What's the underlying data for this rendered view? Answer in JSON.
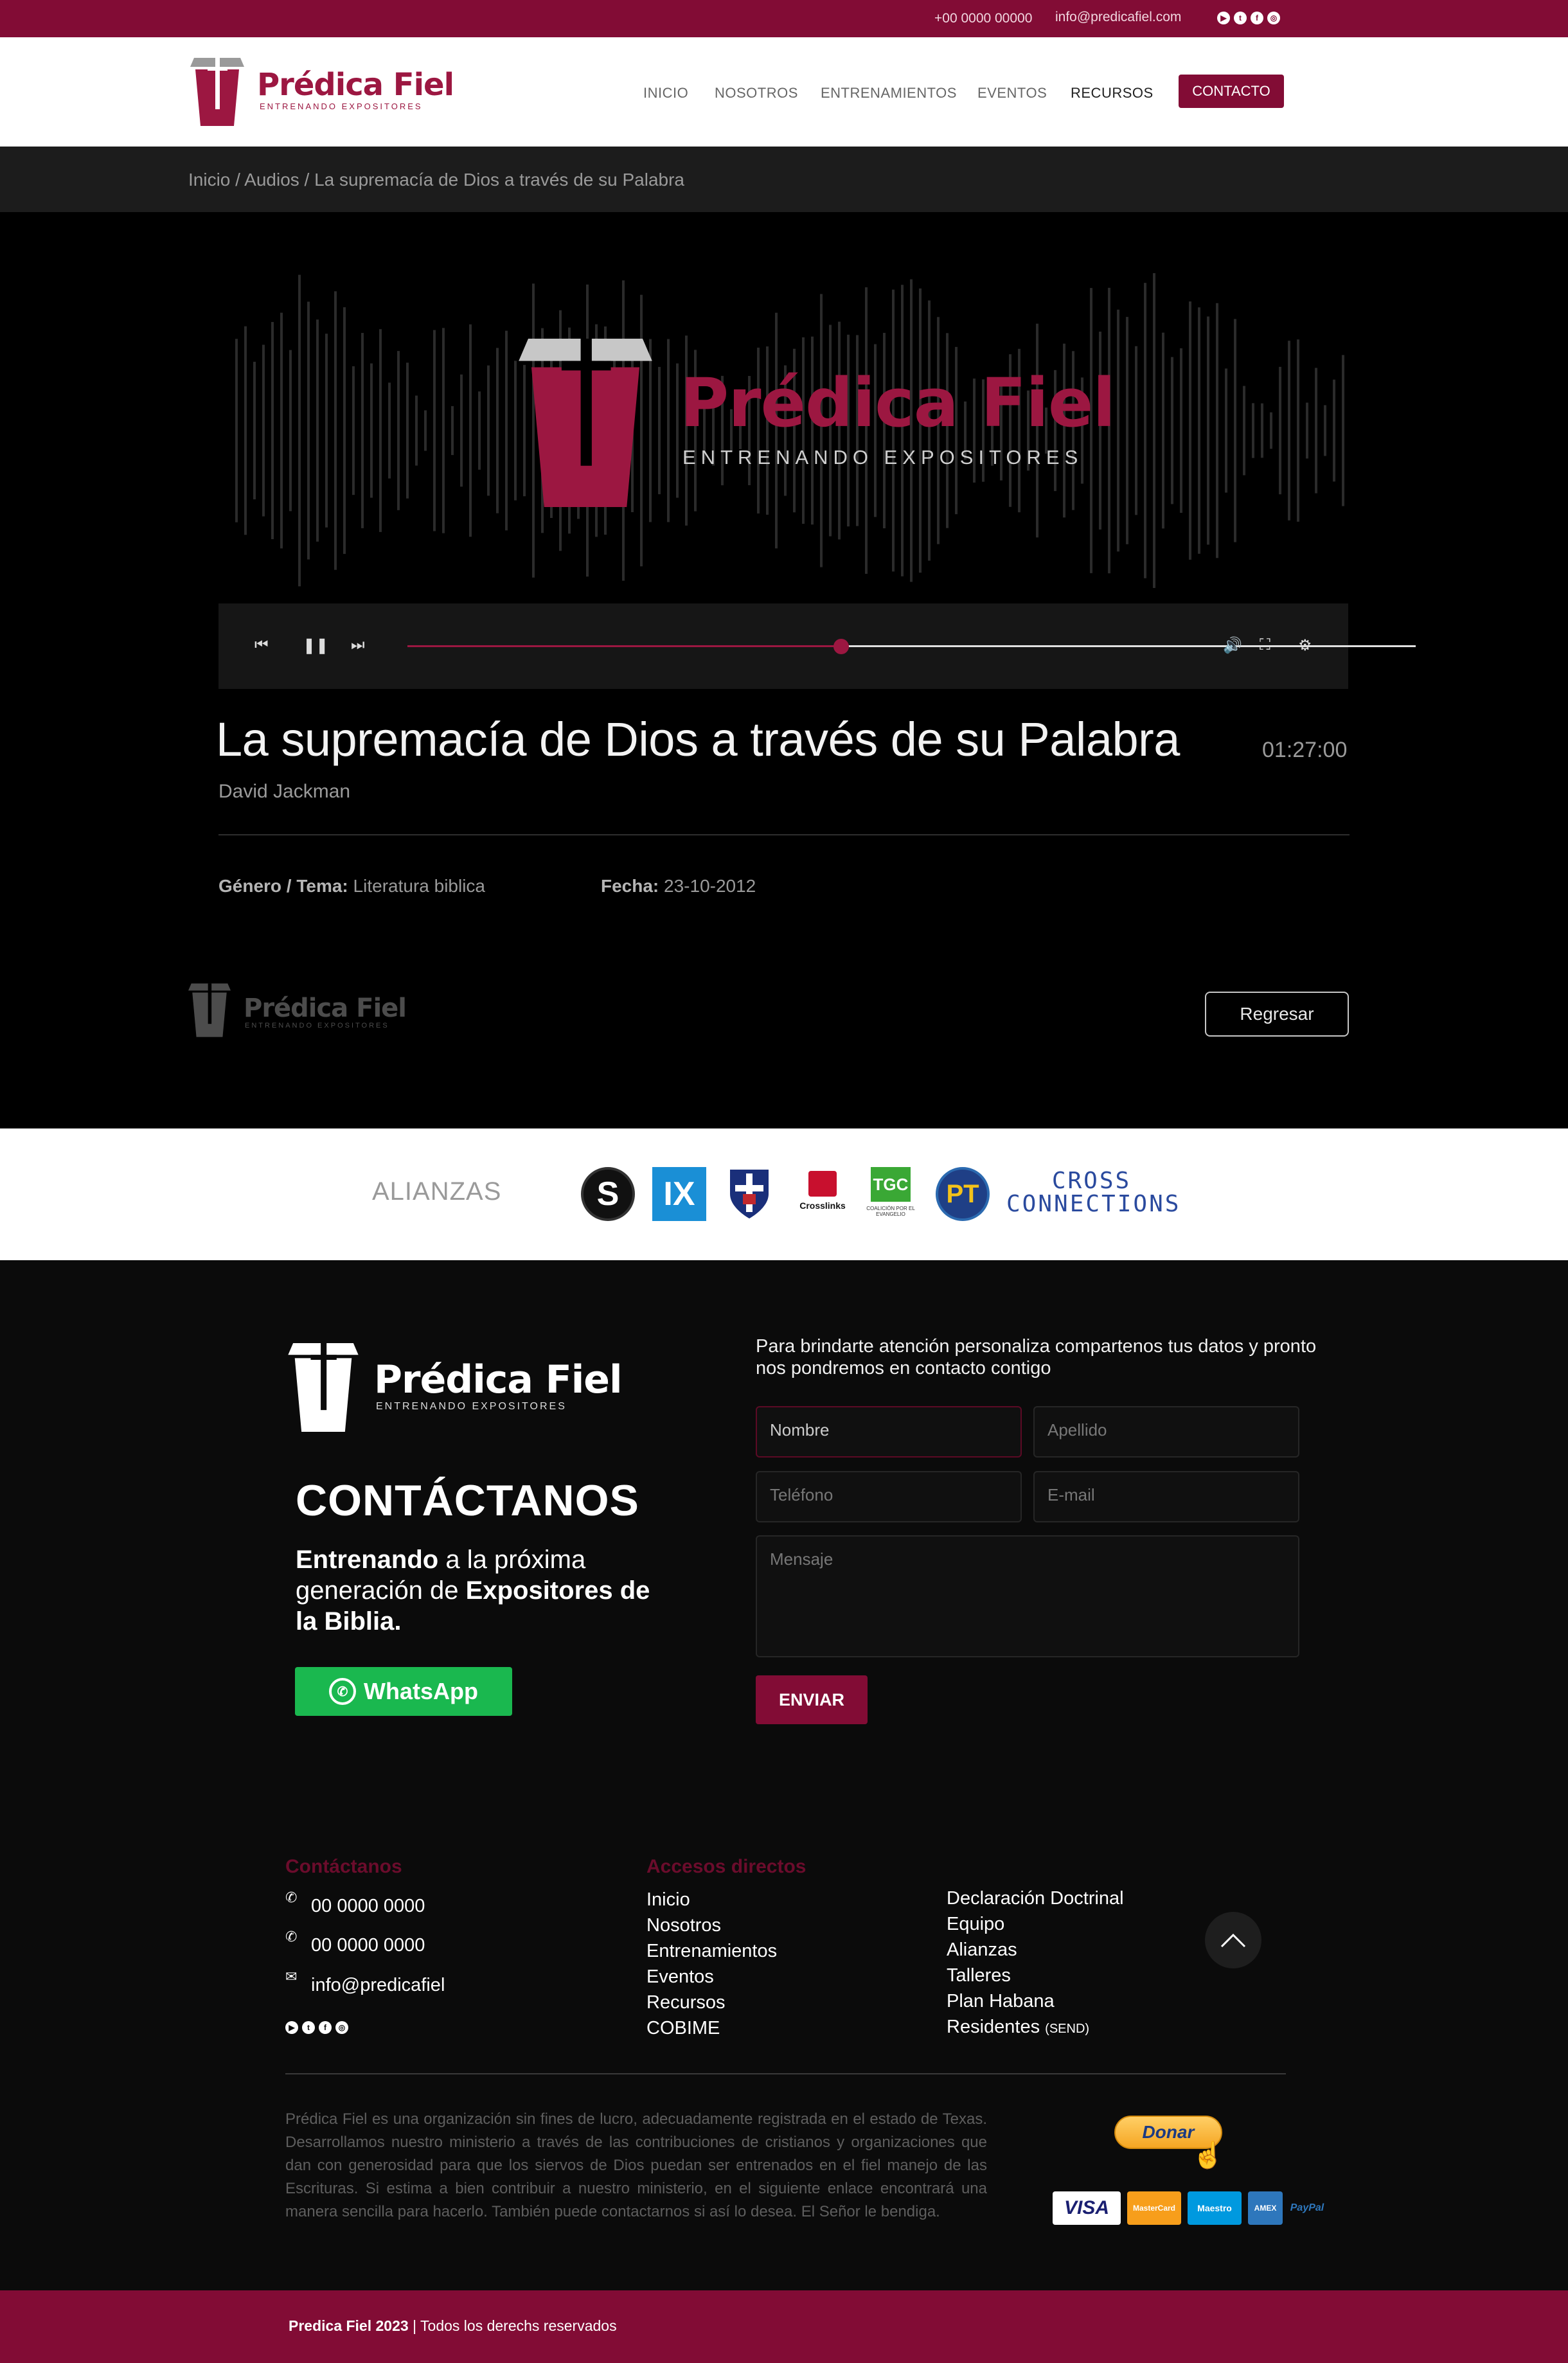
{
  "topbar": {
    "phone": "+00 0000 00000",
    "email": "info@predicafiel.com",
    "social_icons": [
      "youtube-icon",
      "twitter-icon",
      "facebook-icon",
      "instagram-icon"
    ]
  },
  "brand": {
    "name": "Prédica Fiel",
    "tagline": "ENTRENANDO EXPOSITORES",
    "primary_color": "#820c35",
    "accent_color": "#9c1741"
  },
  "nav": {
    "items": [
      "INICIO",
      "NOSOTROS",
      "ENTRENAMIENTOS",
      "EVENTOS",
      "RECURSOS"
    ],
    "active": "RECURSOS",
    "contact": "CONTACTO"
  },
  "breadcrumb": "Inicio / Audios / La supremacía de Dios a través de su Palabra",
  "audio": {
    "title": "La supremacía de Dios a través de su Palabra",
    "author": "David Jackman",
    "duration": "01:27:00",
    "progress": 0.43,
    "genre_label": "Género / Tema:",
    "genre": "Literatura biblica",
    "date_label": "Fecha:",
    "date": "23-10-2012",
    "back": "Regresar"
  },
  "alliances": {
    "label": "ALIANZAS",
    "logos": [
      "S",
      "IX",
      "",
      "Crosslinks",
      "TGC",
      "PT"
    ],
    "crosslinks_sub": "Crosslinks",
    "tgc_sub": "COALICIÓN POR EL EVANGELIO",
    "cross_connections": [
      "CROSS",
      "CONNECTIONS"
    ]
  },
  "contact": {
    "heading": "CONTÁCTANOS",
    "tagline_parts": [
      "Entrenando",
      " a la próxima generación de ",
      "Expositores",
      " de la Biblia."
    ],
    "whatsapp": "WhatsApp",
    "intro": "Para brindarte atención personaliza compartenos tus datos y pronto nos pondremos en contacto contigo",
    "fields": {
      "nombre": "Nombre",
      "apellido": "Apellido",
      "telefono": "Teléfono",
      "email": "E-mail",
      "mensaje": "Mensaje"
    },
    "send": "ENVIAR"
  },
  "footer": {
    "contact_heading": "Contáctanos",
    "phones": [
      "00 0000 0000",
      "00 0000 0000"
    ],
    "email": "info@predicafiel",
    "links_heading": "Accesos directos",
    "links_col1": [
      "Inicio",
      "Nosotros",
      "Entrenamientos",
      "Eventos",
      "Recursos",
      "COBIME"
    ],
    "links_col2": [
      "Declaración Doctrinal",
      "Equipo",
      "Alianzas",
      "Talleres",
      "Plan Habana",
      "Residentes"
    ],
    "send_note": "(SEND)",
    "legal": "Prédica Fiel es una organización sin fines de lucro, adecuadamente registrada en el estado de Texas. Desarrollamos nuestro ministerio a través de las contribuciones de cristianos y organizaciones que dan con generosidad para que los siervos de Dios puedan ser entrenados en el fiel manejo de las Escrituras. Si estima a bien contribuir a nuestro ministerio, en el siguiente enlace encontrará una manera sencilla para hacerlo. También puede contactarnos si así lo desea. El Señor le bendiga.",
    "donate": "Donar",
    "cards": [
      "VISA",
      "MasterCard",
      "Maestro",
      "AMEX",
      "PayPal"
    ],
    "copyright_bold": "Predica Fiel 2023",
    "copyright_rest": " | Todos los derechs reservados"
  }
}
